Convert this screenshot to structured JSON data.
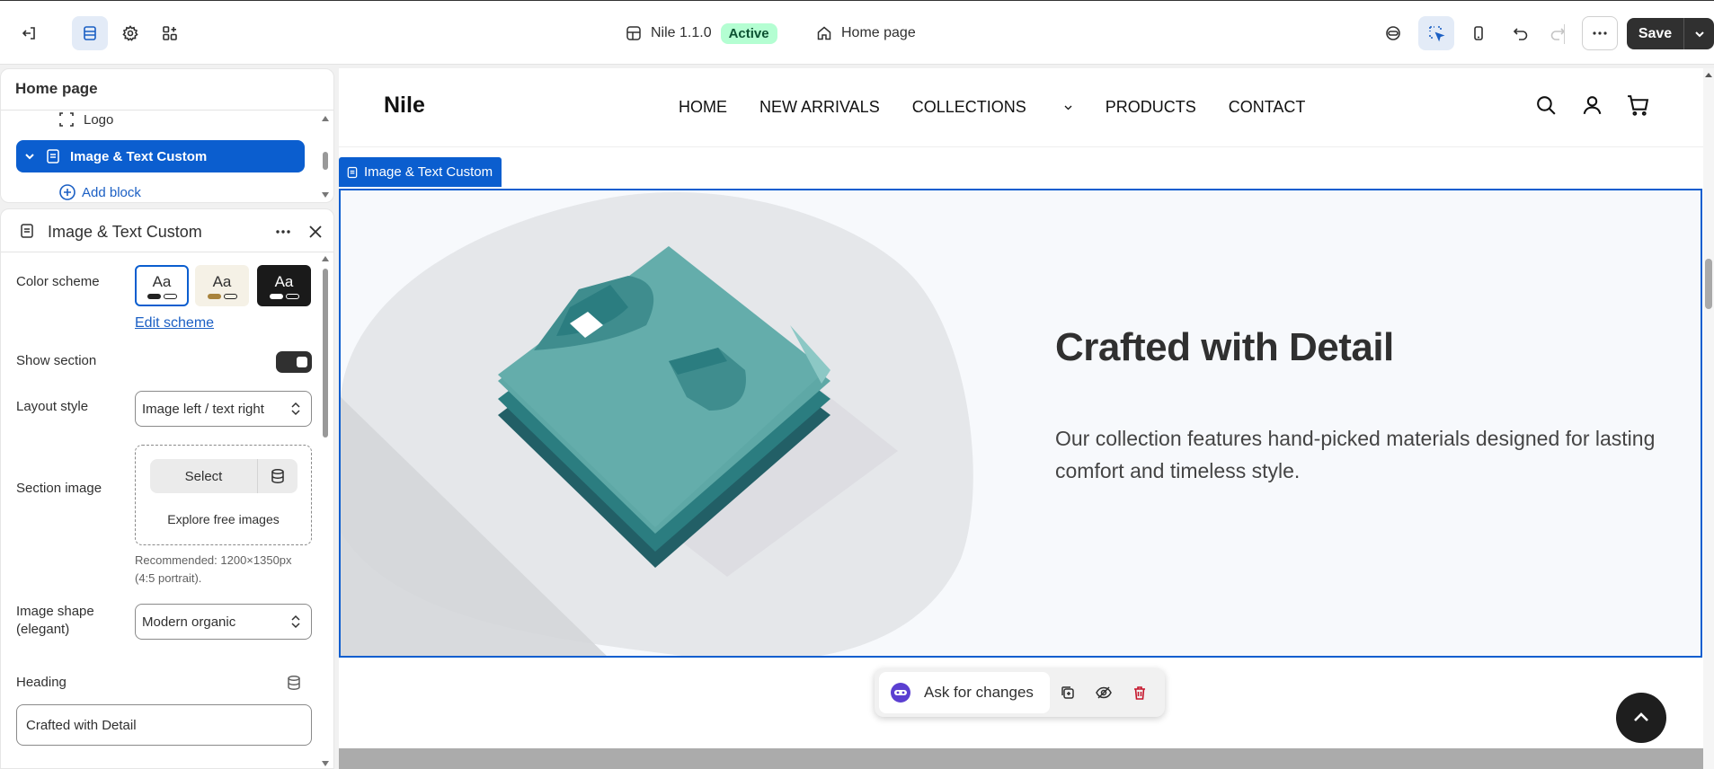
{
  "topbar": {
    "theme_name": "Nile 1.1.0",
    "status": "Active",
    "page": "Home page",
    "save_label": "Save"
  },
  "tree": {
    "title": "Home page",
    "items": [
      {
        "label": "Logo",
        "icon": "dashed-square-icon"
      },
      {
        "label": "Image & Text Custom",
        "icon": "section-icon",
        "selected": true
      }
    ],
    "add_block": "Add block"
  },
  "settings": {
    "title": "Image & Text Custom",
    "color_scheme_label": "Color scheme",
    "swatches": [
      "Aa",
      "Aa",
      "Aa"
    ],
    "edit_scheme": "Edit scheme",
    "show_section_label": "Show section",
    "show_section_on": true,
    "layout_style_label": "Layout style",
    "layout_style_value": "Image left / text right",
    "section_image_label": "Section image",
    "select_label": "Select",
    "explore_label": "Explore free images",
    "recommended_line1": "Recommended: 1200×1350px",
    "recommended_line2": "(4:5 portrait).",
    "image_shape_label": "Image shape",
    "image_shape_label2": "(elegant)",
    "image_shape_value": "Modern organic",
    "heading_label": "Heading",
    "heading_value": "Crafted with Detail"
  },
  "store": {
    "logo": "Nile",
    "nav": [
      "HOME",
      "NEW ARRIVALS",
      "COLLECTIONS",
      "PRODUCTS",
      "CONTACT"
    ],
    "section_tag": "Image & Text Custom",
    "heading": "Crafted with Detail",
    "body": "Our collection features hand-picked materials designed for lasting comfort and timeless style."
  },
  "floater": {
    "ask_label": "Ask for changes"
  },
  "colors": {
    "accent": "#0b5ecf",
    "active_badge": "#b4fed2",
    "shirt": "#5ea8a6",
    "dark": "#303030"
  }
}
